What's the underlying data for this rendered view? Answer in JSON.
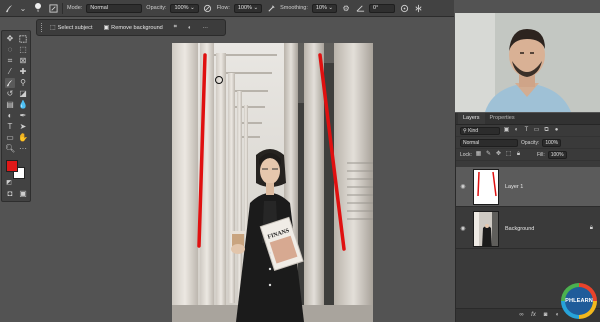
{
  "options_bar": {
    "mode_label": "Mode:",
    "mode_value": "Normal",
    "opacity_label": "Opacity:",
    "opacity_value": "100%",
    "flow_label": "Flow:",
    "flow_value": "100%",
    "smoothing_label": "Smoothing:",
    "smoothing_value": "10%",
    "angle_value": "0°",
    "brush_size": "9"
  },
  "task_bar": {
    "select_subject": "Select subject",
    "remove_background": "Remove background",
    "more": "···"
  },
  "colors": {
    "foreground": "#e01818",
    "background": "#ffffff",
    "stroke": "#e01010"
  },
  "artwork": {
    "book_text": "FINANS"
  },
  "layers_panel": {
    "tabs": [
      "Layers",
      "Properties"
    ],
    "filter_kind": "Kind",
    "blend_mode": "Normal",
    "opacity_label": "Opacity:",
    "opacity_value": "100%",
    "lock_label": "Lock:",
    "fill_label": "Fill:",
    "fill_value": "100%",
    "layers": [
      {
        "name": "Layer 1",
        "visible": true,
        "selected": true
      },
      {
        "name": "Background",
        "visible": true,
        "selected": false,
        "locked": true
      }
    ]
  },
  "logo": {
    "text": "PHLEARN"
  }
}
